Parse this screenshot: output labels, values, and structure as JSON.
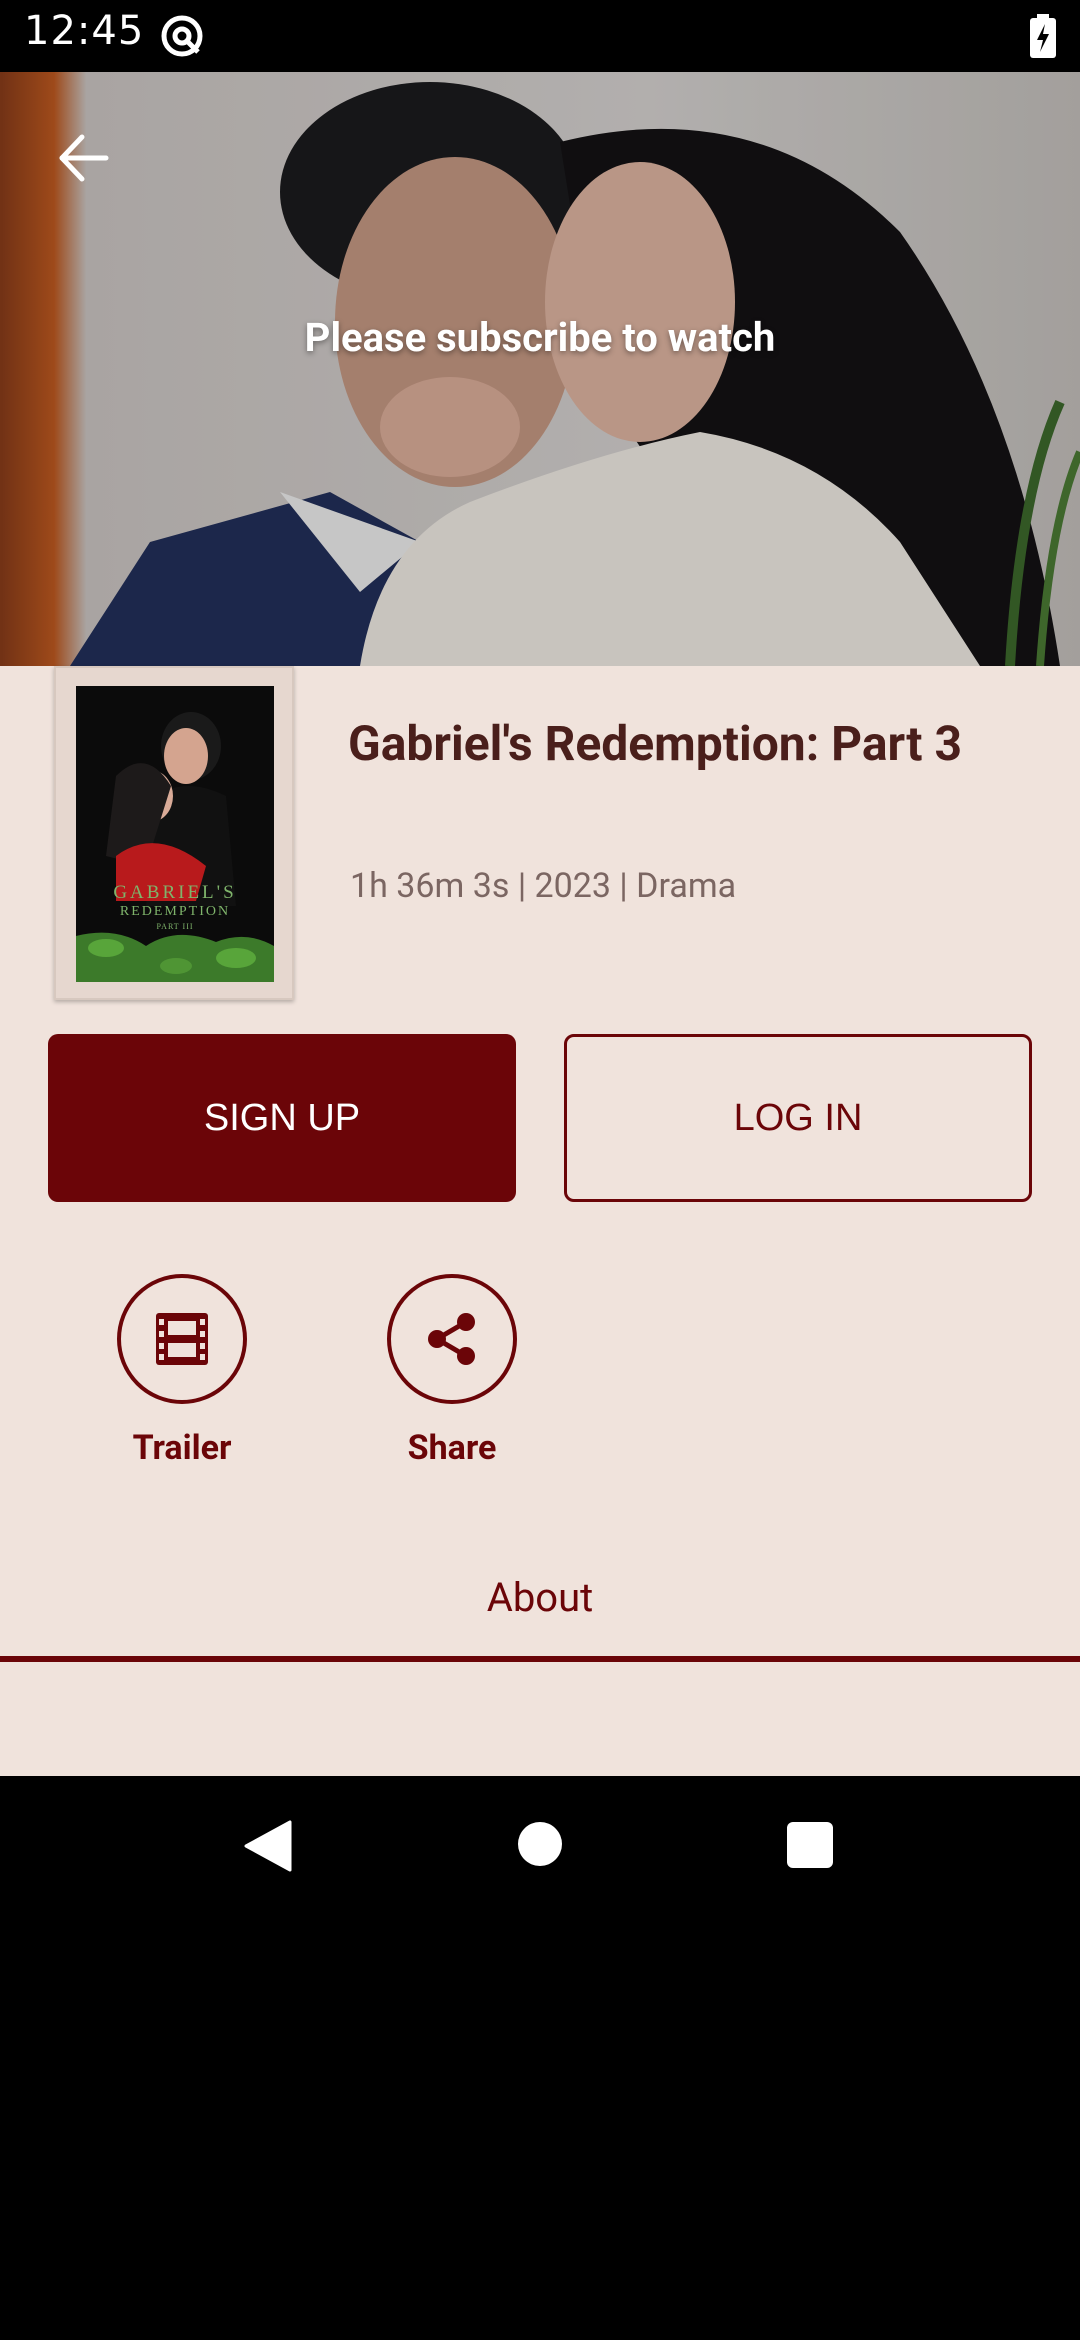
{
  "status_bar": {
    "time": "12:45",
    "app_icon": "at-sign-icon",
    "battery_icon": "battery-charging-icon"
  },
  "hero": {
    "back_icon": "arrow-left-icon",
    "message": "Please subscribe to watch"
  },
  "movie": {
    "title": "Gabriel's Redemption: Part 3",
    "meta": "1h 36m 3s | 2023 | Drama",
    "poster": {
      "line1": "GABRIEL'S",
      "line2": "REDEMPTION",
      "line3": "PART III"
    }
  },
  "buttons": {
    "signup": "SIGN UP",
    "login": "LOG IN"
  },
  "actions": {
    "trailer": {
      "label": "Trailer",
      "icon": "film-icon"
    },
    "share": {
      "label": "Share",
      "icon": "share-icon"
    }
  },
  "tabs": {
    "about": "About"
  },
  "nav": {
    "back": "nav-back-icon",
    "home": "nav-home-icon",
    "recents": "nav-recents-icon"
  },
  "colors": {
    "accent": "#6b0508",
    "background": "#f0e3dc",
    "title": "#4a1f1b",
    "meta": "#7b6662"
  }
}
